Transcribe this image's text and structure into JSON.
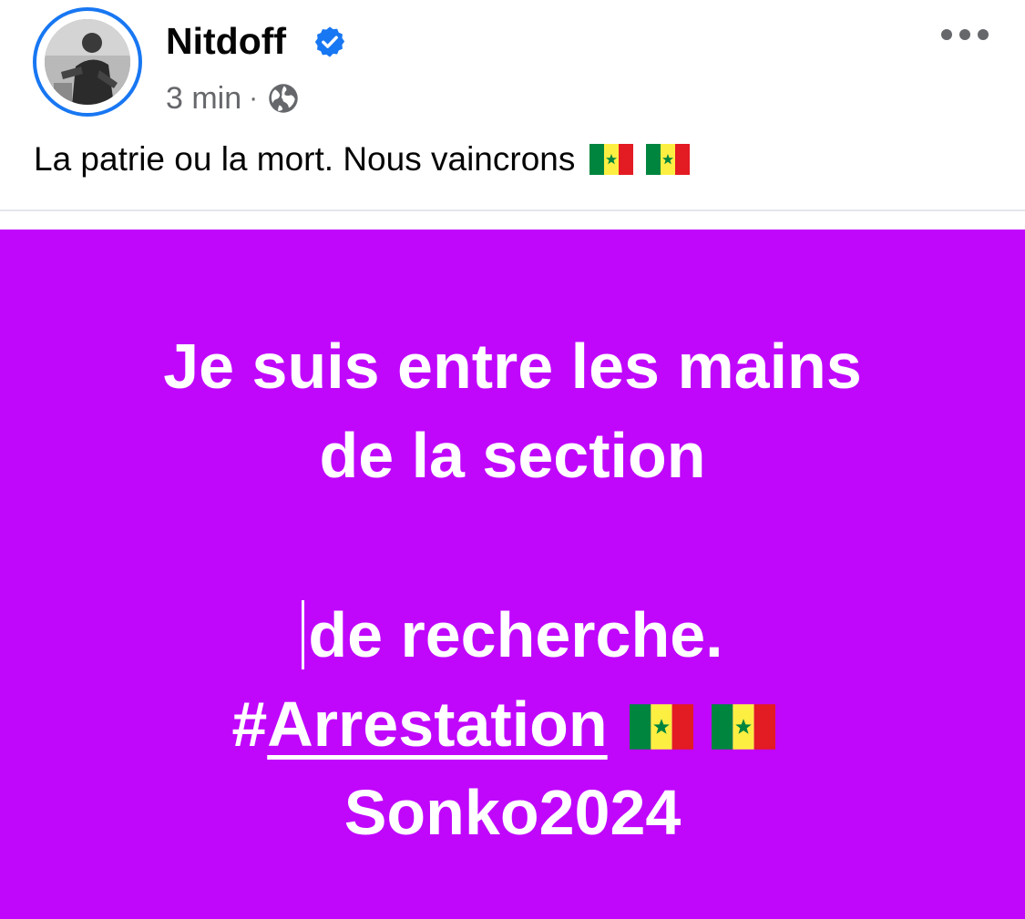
{
  "post": {
    "author": {
      "name": "Nitdoff",
      "verified_icon": "verified-badge-icon",
      "avatar_icon": "avatar"
    },
    "meta": {
      "time": "3 min",
      "separator": "·",
      "audience_icon": "globe-icon"
    },
    "more_icon": "more-options-icon",
    "caption": {
      "text": "La patrie ou la mort. Nous vaincrons",
      "emoji": [
        "senegal-flag",
        "senegal-flag"
      ]
    },
    "image_text": {
      "line1": "Je suis entre les mains",
      "line2": "de la section",
      "line3": "de recherche.",
      "hashtag_prefix": "#",
      "hashtag_word": "Arrestation",
      "line5": "Sonko2024"
    },
    "colors": {
      "image_background": "#c007fc",
      "verified_blue": "#1877f2",
      "meta_gray": "#65676b",
      "flag_green": "#00853f",
      "flag_yellow": "#fdef42",
      "flag_red": "#e31b23"
    }
  }
}
